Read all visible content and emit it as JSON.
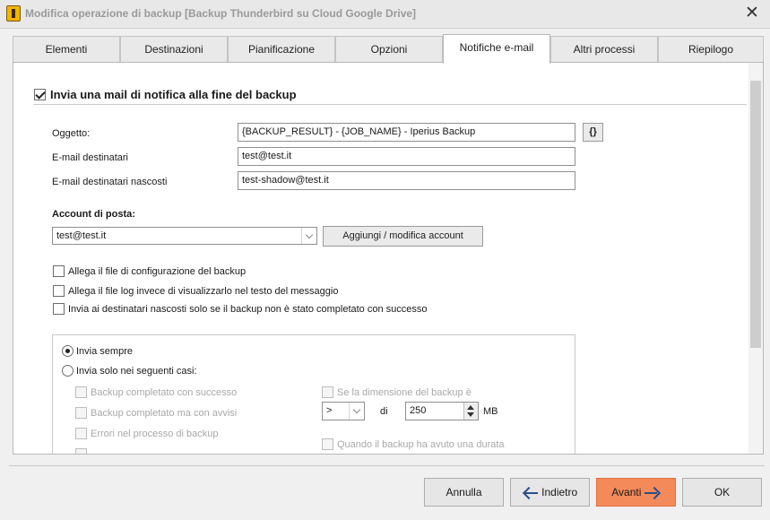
{
  "window": {
    "title": "Modifica operazione di backup    [Backup Thunderbird su Cloud Google Drive]",
    "close_glyph": "✕"
  },
  "tabs": [
    {
      "label": "Elementi"
    },
    {
      "label": "Destinazioni"
    },
    {
      "label": "Pianificazione"
    },
    {
      "label": "Opzioni"
    },
    {
      "label": "Notifiche e-mail",
      "active": true
    },
    {
      "label": "Altri processi"
    },
    {
      "label": "Riepilogo"
    }
  ],
  "notify": {
    "label": "Invia una mail di notifica alla fine del backup",
    "checked": true
  },
  "fields": {
    "subject_label": "Oggetto:",
    "subject_value": "{BACKUP_RESULT} - {JOB_NAME} - Iperius Backup",
    "variables_button": "{}",
    "recipients_label": "E-mail destinatari",
    "recipients_value": "test@test.it",
    "bcc_label": "E-mail destinatari nascosti",
    "bcc_value": "test-shadow@test.it"
  },
  "account": {
    "label": "Account di posta:",
    "selected": "test@test.it",
    "manage_button": "Aggiungi / modifica account"
  },
  "options": [
    {
      "label": "Allega il file di configurazione del backup",
      "checked": false
    },
    {
      "label": "Allega il file log invece di visualizzarlo nel testo del messaggio",
      "checked": false
    },
    {
      "label": "Invia ai destinatari nascosti solo se il backup non è stato completato con successo",
      "checked": false
    }
  ],
  "send_mode": {
    "always_label": "Invia sempre",
    "always_selected": true,
    "conditional_label": "Invia solo nei seguenti casi:",
    "conditional_selected": false
  },
  "conditions": [
    {
      "label": "Backup completato con successo"
    },
    {
      "label": "Backup completato ma con avvisi"
    },
    {
      "label": "Errori nel processo di backup"
    },
    {
      "label": "Se la dimensione del backup è"
    },
    {
      "label": "Quando il backup ha avuto una durata"
    }
  ],
  "size_condition": {
    "operator": ">",
    "di_label": "di",
    "value": "250",
    "unit": "MB"
  },
  "footer": {
    "cancel": "Annulla",
    "back": "Indietro",
    "next": "Avanti",
    "ok": "OK"
  },
  "colors": {
    "primary_button": "#f48a5a",
    "arrow_icon": "#2a4f8a"
  }
}
